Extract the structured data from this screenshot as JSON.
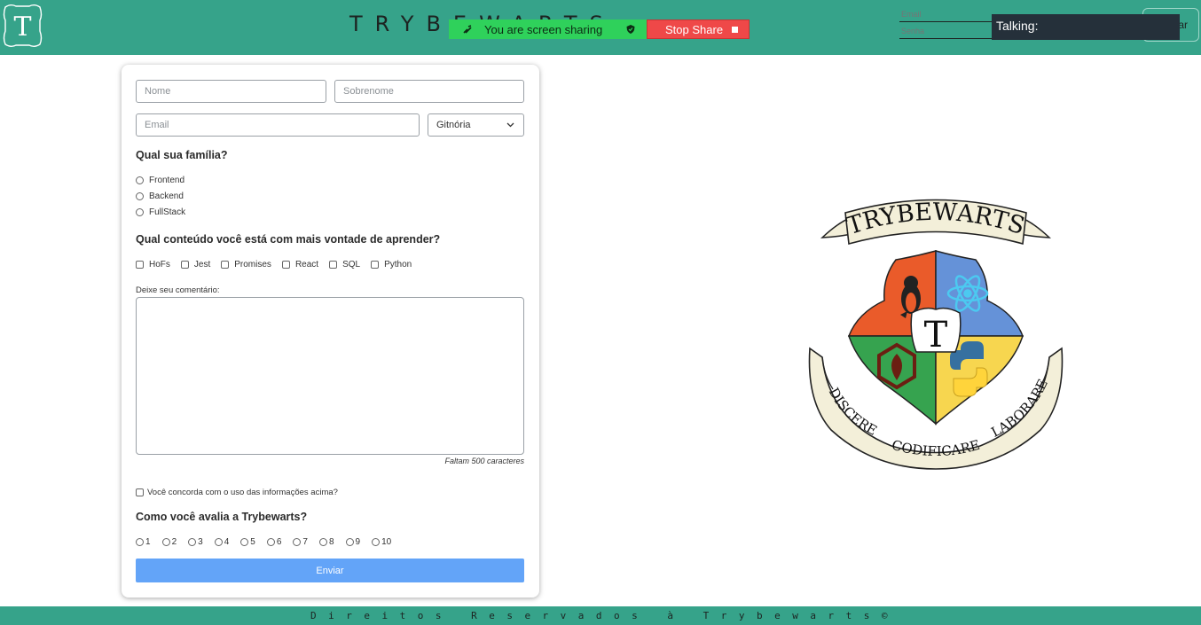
{
  "header": {
    "title": "TRYBEWARTS",
    "logo_letter": "T",
    "login": {
      "email_placeholder": "Email",
      "password_placeholder": "Senha",
      "button_label": "Entrar"
    }
  },
  "screen_share": {
    "status_text": "You are screen sharing",
    "stop_label": "Stop Share"
  },
  "talking": {
    "label": "Talking:"
  },
  "form": {
    "name_placeholder": "Nome",
    "lastname_placeholder": "Sobrenome",
    "email_placeholder": "Email",
    "house_selected": "Gitnória",
    "family_question": "Qual sua família?",
    "family_options": [
      "Frontend",
      "Backend",
      "FullStack"
    ],
    "content_question": "Qual conteúdo você está com mais vontade de aprender?",
    "content_options": [
      "HoFs",
      "Jest",
      "Promises",
      "React",
      "SQL",
      "Python"
    ],
    "comment_label": "Deixe seu comentário:",
    "counter_text": "Faltam 500 caracteres",
    "agreement_label": "Você concorda com o uso das informações acima?",
    "rating_question": "Como você avalia a Trybewarts?",
    "rating_options": [
      "1",
      "2",
      "3",
      "4",
      "5",
      "6",
      "7",
      "8",
      "9",
      "10"
    ],
    "submit_label": "Enviar"
  },
  "crest": {
    "banner_title": "TRYBEWARTS",
    "center_letter": "T",
    "motto_left": "DISCERE",
    "motto_center": "CODIFICARE",
    "motto_right": "LABORARE"
  },
  "footer": {
    "text": "Direitos Reservados à Trybewarts©"
  },
  "colors": {
    "header_bg": "#36a38a",
    "submit_bg": "#63a4f8",
    "share_green": "#2fd15b",
    "share_red": "#ef4848"
  }
}
